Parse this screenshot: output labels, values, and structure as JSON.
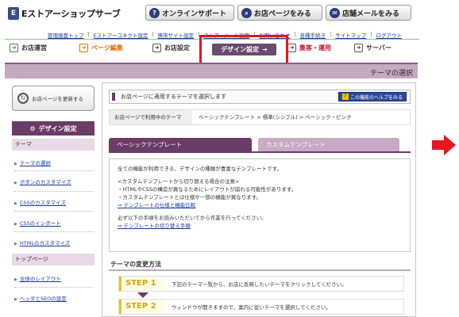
{
  "header": {
    "logo_text": "Eストアーショップサーブ",
    "buttons": [
      {
        "label": "オンラインサポート",
        "icon": "question-icon"
      },
      {
        "label": "お店ページをみる",
        "icon": "search-icon"
      },
      {
        "label": "店舗メールをみる",
        "icon": "mail-icon"
      }
    ]
  },
  "sublinks": [
    "管理画面トップ",
    "Eストアーコネクト設定",
    "携帯サイト設定",
    "ストアーメール設定",
    "お問い合わせ",
    "各種手続き",
    "サイトマップ",
    "ログアウト"
  ],
  "nav": {
    "items": [
      "お店運営",
      "ページ編集",
      "お店設定",
      "デザイン設定",
      "集客・運用",
      "サーバー"
    ]
  },
  "section_title": "テーマの選択",
  "sidebar": {
    "refresh_label": "お店ページを更新する",
    "heading": "デザイン設定",
    "categories": [
      "テーマ",
      "トップページ"
    ],
    "theme_links": [
      "テーマの選択",
      "ボタンのカスタマイズ",
      "CSSのカスタマイズ",
      "CSSのインポート",
      "HTMLのカスタマイズ"
    ],
    "top_links": [
      "全体のレイアウト",
      "ヘッダとSEOの設定"
    ]
  },
  "main": {
    "theme_bar_text": "お店ページに適用するテーマを選択します",
    "help_label": "この機能のヘルプをみる",
    "current_label": "お店ページで利用中のテーマ",
    "current_value": "ベーシックテンプレート > 標準(シンプル) > ベーシック・ピンク",
    "tabs": [
      "ベーシックテンプレート",
      "カスタムテンプレート"
    ],
    "desc_lines": [
      "全ての機能が利用できる、デザインの種類が豊富なテンプレートです。",
      "<カスタムテンプレートから切り替える場合の注意>",
      "・HTMLやCSSの構造が異なるためにレイアウトが崩れる可能性があります。",
      "・カスタムテンプレートとは仕様や一部の機能が異なります。"
    ],
    "desc_link1": "⇒ テンプレートの仕様と機能比較",
    "desc_line5": "必ず以下の手順をお読みいただいてから作業を行ってください。",
    "desc_link2": "⇒ テンプレートの切り替え手順",
    "change_heading": "テーマの変更方法",
    "steps": [
      {
        "label": "STEP 1",
        "text": "下記のテーマ一覧から、お店に反映したいテーマをクリックしてください。"
      },
      {
        "label": "STEP 2",
        "text": "ウィンドウが開きますので、案内に従いテーマを選択してください。"
      }
    ]
  },
  "colors": {
    "accent_purple": "#6b3c68",
    "highlight_red": "#e8151e",
    "band_pink": "#c3a9c1"
  }
}
